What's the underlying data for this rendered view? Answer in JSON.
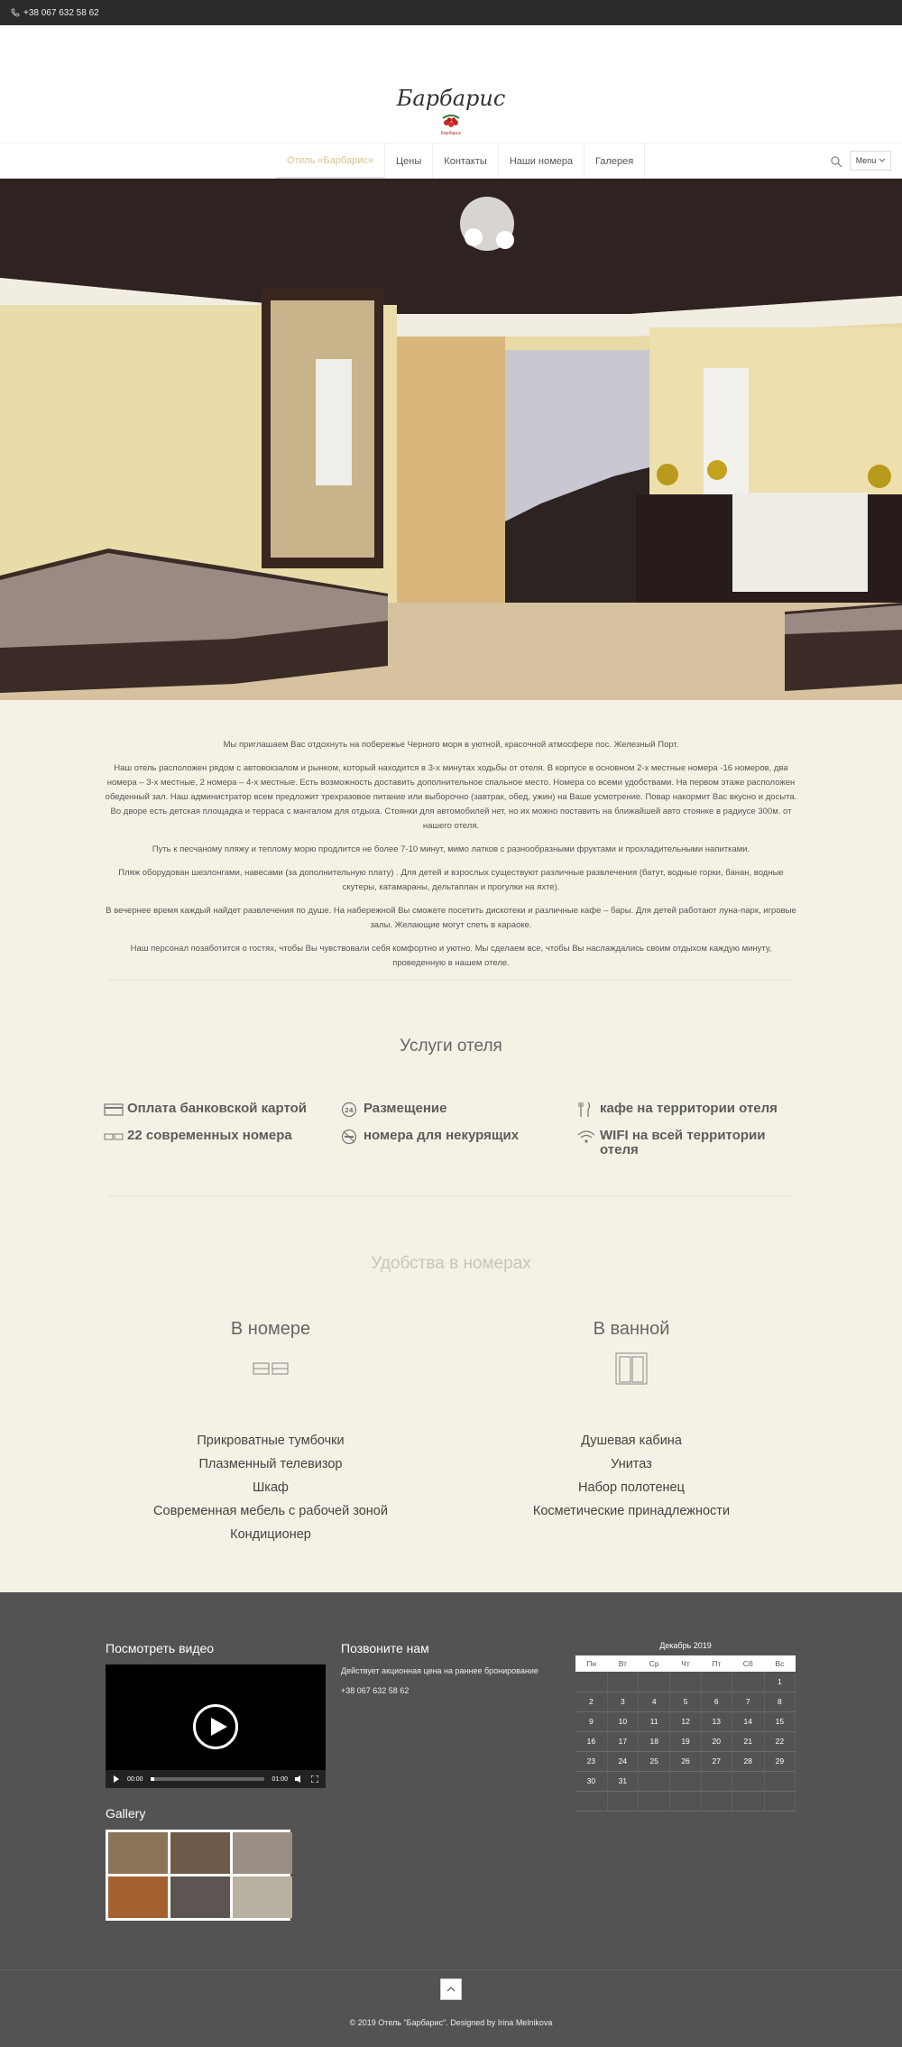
{
  "topbar": {
    "phone": "+38 067 632 58 62"
  },
  "logo": {
    "text": "Барбарис",
    "sub": "Барбарис"
  },
  "nav": {
    "items": [
      "Отель «Барбарис»",
      "Цены",
      "Контакты",
      "Наши номера",
      "Галерея"
    ],
    "menu_label": "Menu"
  },
  "intro": {
    "paragraphs": [
      "Мы приглашаем Вас отдохнуть на побережье Черного моря в    уютной, красочной атмосфере пос. Железный Порт.",
      "Наш отель расположен рядом с автовокзалом и рынком, который находится в 3-х минутах ходьбы от отеля. В корпусе в основном  2-х местные номера -16 номеров, два номера – 3-х местные, 2 номера – 4-х местные. Есть возможность доставить дополнительное спальное место. Номера со всеми удобствами. На первом этаже расположен обеденный зал. Наш администратор всем предложит трехразовое питание или выборочно (завтрак, обед, ужин) на Ваше усмотрение. Повар накормит Вас вкусно и досыта. Во дворе есть детская площадка и терраса с мангалом для отдыха. Стоянки для автомобилей нет, но их можно поставить  на ближайшей авто стоянке в радиусе 300м. от нашего отеля.",
      "Путь к песчаному пляжу и теплому морю продлится не более 7-10 минут, мимо латков с разнообразными фруктами и прохладительными напитками.",
      "Пляж оборудован шезлонгами, навесами (за дополнительную плату) .  Для детей и взрослых  существуют различные развлечения (батут, водные горки, банан, водные скутеры, катамараны, дельтаплан и прогулки на яхте).",
      "В вечернее время каждый найдет развлечения по душе. На набережной Вы сможете посетить  дискотеки и различные кафе – бары. Для детей работают луна-парк, игровые залы. Желающие могут спеть в караоке.",
      "Наш персонал позаботится о гостях, чтобы Вы чувствовали себя комфортно и уютно. Мы сделаем все, чтобы Вы наслаждались своим отдыхом каждую минуту, проведенную в нашем отеле."
    ]
  },
  "services": {
    "title": "Услуги отеля",
    "items": [
      {
        "label": "Оплата банковской картой",
        "icon": "credit-card-icon"
      },
      {
        "label": "Размещение",
        "icon": "24h-icon"
      },
      {
        "label": "кафе на территории отеля",
        "icon": "cutlery-icon"
      },
      {
        "label": "22 современных номера",
        "icon": "beds-icon"
      },
      {
        "label": "номера для некурящих",
        "icon": "no-smoking-icon"
      },
      {
        "label": "WIFI  на всей территории отеля",
        "icon": "wifi-icon"
      }
    ]
  },
  "amenities": {
    "title": "Удобства в номерах",
    "room": {
      "heading": "В номере",
      "items": [
        "Прикроватные тумбочки",
        "Плазменный телевизор",
        "Шкаф",
        "Современная мебель с рабочей зоной",
        "Кондиционер"
      ]
    },
    "bath": {
      "heading": "В ванной",
      "items": [
        "Душевая кабина",
        "Унитаз",
        "Набор полотенец",
        "Косметические принадлежности"
      ]
    }
  },
  "footer": {
    "video_title": "Посмотреть видео",
    "video_time_current": "00:00",
    "video_time_total": "01:00",
    "gallery_title": "Gallery",
    "call_title": "Позвоните нам",
    "call_text": "Действует акционная цена на раннее бронирование",
    "call_phone": "+38 067 632 58 62",
    "calendar": {
      "title": "Декабрь 2019",
      "days": [
        "Пн",
        "Вт",
        "Ср",
        "Чт",
        "Пт",
        "Сб",
        "Вс"
      ],
      "weeks": [
        [
          "",
          "",
          "",
          "",
          "",
          "",
          "1"
        ],
        [
          "2",
          "3",
          "4",
          "5",
          "6",
          "7",
          "8"
        ],
        [
          "9",
          "10",
          "11",
          "12",
          "13",
          "14",
          "15"
        ],
        [
          "16",
          "17",
          "18",
          "19",
          "20",
          "21",
          "22"
        ],
        [
          "23",
          "24",
          "25",
          "26",
          "27",
          "28",
          "29"
        ],
        [
          "30",
          "31",
          "",
          "",
          "",
          "",
          ""
        ],
        [
          "",
          "",
          "",
          "",
          "",
          "",
          ""
        ]
      ]
    },
    "copyright": "© 2019 Отель \"Барбарис\". Designed by Irina Melnikova"
  }
}
